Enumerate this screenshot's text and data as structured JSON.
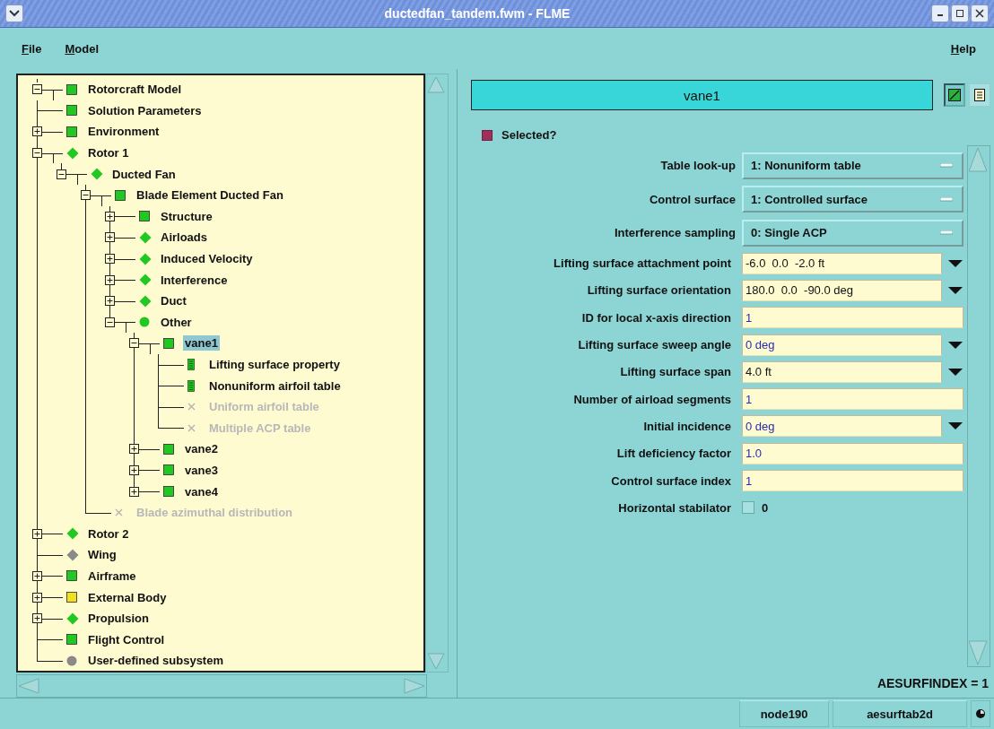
{
  "window": {
    "title": "ductedfan_tandem.fwm - FLME"
  },
  "menu": {
    "left": [
      "File",
      "Model"
    ],
    "right": [
      "Help"
    ]
  },
  "tree": [
    {
      "label": "Rotorcraft Model",
      "kind": "square",
      "color": "#22c822",
      "expanded": true,
      "disabled": false,
      "selected": false,
      "children": [
        {
          "label": "Solution Parameters",
          "kind": "square",
          "color": "#22c822",
          "disabled": false,
          "selected": false
        },
        {
          "label": "Environment",
          "kind": "square",
          "color": "#22c822",
          "expanded": false,
          "disabled": false,
          "selected": false
        },
        {
          "label": "Rotor 1",
          "kind": "diamond",
          "color": "#22c822",
          "expanded": true,
          "disabled": false,
          "selected": false,
          "children": [
            {
              "label": "Ducted Fan",
              "kind": "diamond",
              "color": "#22c822",
              "expanded": true,
              "disabled": false,
              "selected": false,
              "children": [
                {
                  "label": "Blade Element Ducted Fan",
                  "kind": "square",
                  "color": "#22c822",
                  "expanded": true,
                  "disabled": false,
                  "selected": false,
                  "children": [
                    {
                      "label": "Structure",
                      "kind": "square",
                      "color": "#22c822",
                      "expanded": false,
                      "disabled": false,
                      "selected": false
                    },
                    {
                      "label": "Airloads",
                      "kind": "diamond",
                      "color": "#22c822",
                      "expanded": false,
                      "disabled": false,
                      "selected": false
                    },
                    {
                      "label": "Induced Velocity",
                      "kind": "diamond",
                      "color": "#22c822",
                      "expanded": false,
                      "disabled": false,
                      "selected": false
                    },
                    {
                      "label": "Interference",
                      "kind": "diamond",
                      "color": "#22c822",
                      "expanded": false,
                      "disabled": false,
                      "selected": false
                    },
                    {
                      "label": "Duct",
                      "kind": "diamond",
                      "color": "#22c822",
                      "expanded": false,
                      "disabled": false,
                      "selected": false
                    },
                    {
                      "label": "Other",
                      "kind": "circle",
                      "color": "#22c822",
                      "expanded": true,
                      "disabled": false,
                      "selected": false,
                      "children": [
                        {
                          "label": "vane1",
                          "kind": "square",
                          "color": "#22c822",
                          "expanded": true,
                          "disabled": false,
                          "selected": true,
                          "children": [
                            {
                              "label": "Lifting surface property",
                              "kind": "doc",
                              "color": "#22c822",
                              "disabled": false,
                              "selected": false
                            },
                            {
                              "label": "Nonuniform airfoil table",
                              "kind": "doc",
                              "color": "#22c822",
                              "disabled": false,
                              "selected": false
                            },
                            {
                              "label": "Uniform airfoil table",
                              "kind": "cross",
                              "color": "#b0b0b0",
                              "disabled": true,
                              "selected": false
                            },
                            {
                              "label": "Multiple ACP table",
                              "kind": "cross",
                              "color": "#b0b0b0",
                              "disabled": true,
                              "selected": false
                            }
                          ]
                        },
                        {
                          "label": "vane2",
                          "kind": "square",
                          "color": "#22c822",
                          "expanded": false,
                          "disabled": false,
                          "selected": false
                        },
                        {
                          "label": "vane3",
                          "kind": "square",
                          "color": "#22c822",
                          "expanded": false,
                          "disabled": false,
                          "selected": false
                        },
                        {
                          "label": "vane4",
                          "kind": "square",
                          "color": "#22c822",
                          "expanded": false,
                          "disabled": false,
                          "selected": false
                        }
                      ]
                    }
                  ]
                },
                {
                  "label": "Blade azimuthal distribution",
                  "kind": "cross",
                  "color": "#b0b0b0",
                  "disabled": true,
                  "selected": false
                }
              ]
            }
          ]
        },
        {
          "label": "Rotor 2",
          "kind": "diamond",
          "color": "#22c822",
          "expanded": false,
          "disabled": false,
          "selected": false
        },
        {
          "label": "Wing",
          "kind": "diamond",
          "color": "#8a8a8a",
          "disabled": false,
          "selected": false
        },
        {
          "label": "Airframe",
          "kind": "square",
          "color": "#22c822",
          "expanded": false,
          "disabled": false,
          "selected": false
        },
        {
          "label": "External Body",
          "kind": "square",
          "color": "#f0e020",
          "expanded": false,
          "disabled": false,
          "selected": false
        },
        {
          "label": "Propulsion",
          "kind": "diamond",
          "color": "#22c822",
          "expanded": false,
          "disabled": false,
          "selected": false
        },
        {
          "label": "Flight Control",
          "kind": "square",
          "color": "#22c822",
          "disabled": false,
          "selected": false
        },
        {
          "label": "User-defined subsystem",
          "kind": "circle",
          "color": "#8a8a8a",
          "disabled": false,
          "selected": false
        }
      ]
    }
  ],
  "panel": {
    "name": "vane1",
    "selected_label": "Selected?",
    "selected_checked": true,
    "fields": [
      {
        "kind": "dropdown",
        "label": "Table look-up",
        "value": "1: Nonuniform table"
      },
      {
        "kind": "dropdown",
        "label": "Control surface",
        "value": "1: Controlled surface"
      },
      {
        "kind": "dropdown",
        "label": "Interference sampling",
        "value": "0: Single ACP"
      },
      {
        "kind": "unit",
        "label": "Lifting surface attachment point",
        "value": "-6.0  0.0  -2.0 ft",
        "default": false
      },
      {
        "kind": "unit",
        "label": "Lifting surface orientation",
        "value": "180.0  0.0  -90.0 deg",
        "default": false
      },
      {
        "kind": "input",
        "label": "ID for local x-axis direction",
        "value": "1",
        "default": true
      },
      {
        "kind": "unit",
        "label": "Lifting surface sweep angle",
        "value": "0 deg",
        "default": true
      },
      {
        "kind": "unit",
        "label": "Lifting surface span",
        "value": "4.0 ft",
        "default": false
      },
      {
        "kind": "input",
        "label": "Number of airload segments",
        "value": "1",
        "default": true
      },
      {
        "kind": "unit",
        "label": "Initial incidence",
        "value": "0 deg",
        "default": true
      },
      {
        "kind": "input",
        "label": "Lift deficiency factor",
        "value": "1.0",
        "default": true
      },
      {
        "kind": "input",
        "label": "Control surface index",
        "value": "1",
        "default": true
      },
      {
        "kind": "checkbox",
        "label": "Horizontal stabilator",
        "value": "0",
        "checked": false
      }
    ],
    "footer": "AESURFINDEX = 1"
  },
  "status_bar": [
    "node190",
    "aesurftab2d"
  ]
}
